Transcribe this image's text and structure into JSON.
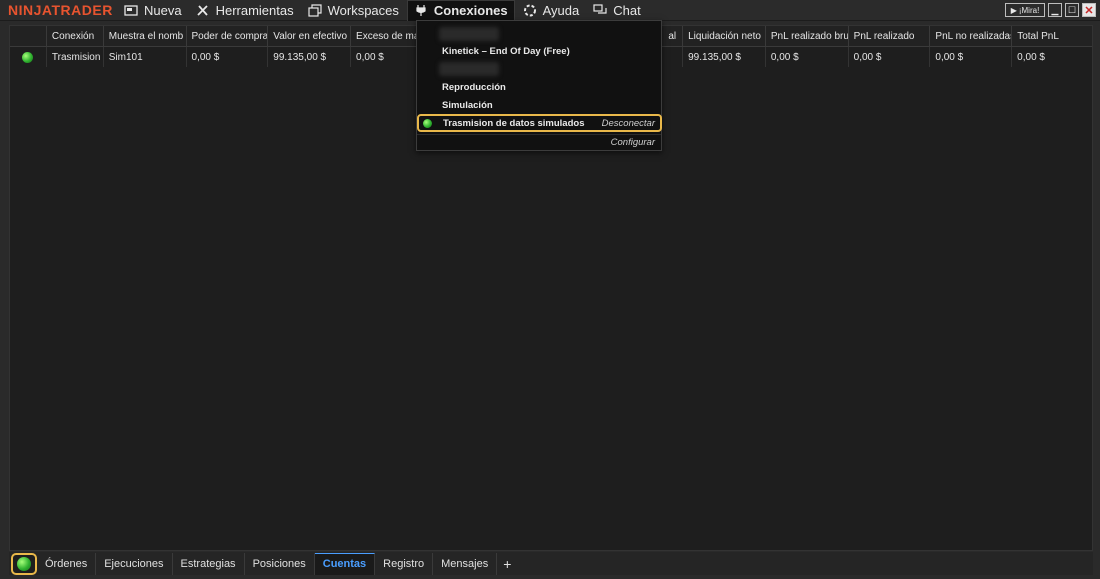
{
  "app": {
    "logo": "NINJATRADER"
  },
  "menu": [
    {
      "label": "Nueva",
      "icon": "window-icon"
    },
    {
      "label": "Herramientas",
      "icon": "tools-icon"
    },
    {
      "label": "Workspaces",
      "icon": "workspaces-icon"
    },
    {
      "label": "Conexiones",
      "icon": "plug-icon",
      "active": true
    },
    {
      "label": "Ayuda",
      "icon": "help-icon"
    },
    {
      "label": "Chat",
      "icon": "chat-icon"
    }
  ],
  "window_controls": {
    "mira_label": "¡Mira!"
  },
  "grid": {
    "columns": [
      "",
      "Conexión",
      "Muestra el nomb",
      "Poder de compra",
      "Valor en efectivo",
      "Exceso de ma",
      "",
      "",
      "al",
      "Liquidación neto",
      "PnL realizado bru",
      "PnL realizado",
      "PnL no realizadas",
      "Total PnL"
    ],
    "rows": [
      {
        "status": "connected",
        "cells": [
          "",
          "Trasmision",
          "Sim101",
          "0,00 $",
          "99.135,00 $",
          "0,00 $",
          "",
          "",
          "",
          "99.135,00 $",
          "0,00 $",
          "0,00 $",
          "0,00 $",
          "0,00 $"
        ]
      }
    ]
  },
  "dropdown": {
    "items": [
      "Kinetick – End Of Day (Free)",
      "Reproducción",
      "Simulación"
    ],
    "highlighted": {
      "label": "Trasmision de datos simulados",
      "action": "Desconectar"
    },
    "configure": "Configurar"
  },
  "tabs": [
    "Órdenes",
    "Ejecuciones",
    "Estrategias",
    "Posiciones",
    "Cuentas",
    "Registro",
    "Mensajes"
  ],
  "active_tab": "Cuentas",
  "tab_add": "+",
  "colors": {
    "accent": "#4a9eff",
    "highlight": "#e9b84a",
    "logo": "#e8542f",
    "connected": "#2fb12f"
  }
}
